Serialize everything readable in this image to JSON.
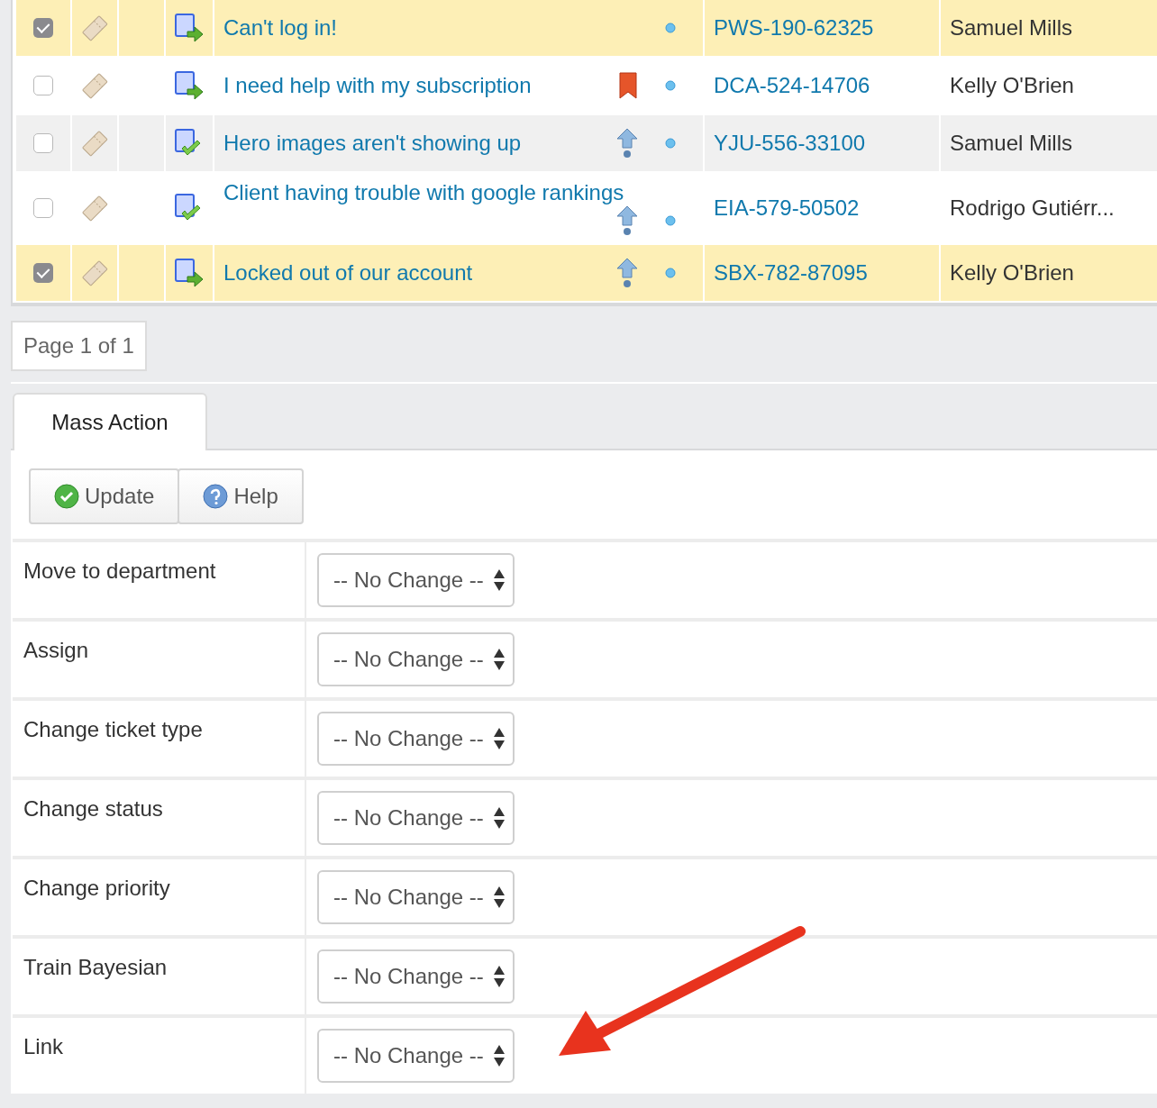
{
  "tickets": [
    {
      "selected": true,
      "status_icon": {
        "kind": "moved"
      },
      "subject": "Can't log in!",
      "ticket_id": "PWS-190-62325",
      "owner": "Samuel Mills"
    },
    {
      "selected": false,
      "status_icon": {
        "kind": "moved"
      },
      "subject": "I need help with my subscription",
      "flag_icon": {
        "kind": "bookmark"
      },
      "ticket_id": "DCA-524-14706",
      "owner": "Kelly O'Brien"
    },
    {
      "selected": false,
      "status_icon": {
        "kind": "done"
      },
      "subject": "Hero images aren't showing up",
      "flag_icon": {
        "kind": "priority"
      },
      "ticket_id": "YJU-556-33100",
      "owner": "Samuel Mills"
    },
    {
      "selected": false,
      "status_icon": {
        "kind": "done"
      },
      "subject": "Client having trouble with google rankings",
      "flag_icon": {
        "kind": "priority"
      },
      "ticket_id": "EIA-579-50502",
      "owner": "Rodrigo Gutiérr..."
    },
    {
      "selected": true,
      "status_icon": {
        "kind": "moved"
      },
      "subject": "Locked out of our account",
      "flag_icon": {
        "kind": "priority"
      },
      "ticket_id": "SBX-782-87095",
      "owner": "Kelly O'Brien"
    }
  ],
  "pagination": "Page 1 of 1",
  "tabs": [
    {
      "label": "Mass Action",
      "selected": true
    }
  ],
  "toolbar": [
    {
      "kind": "update",
      "label": "Update"
    },
    {
      "kind": "help",
      "label": "Help"
    }
  ],
  "fields": [
    {
      "label": "Move to department",
      "value": "-- No Change --"
    },
    {
      "label": "Assign",
      "value": "-- No Change --"
    },
    {
      "label": "Change ticket type",
      "value": "-- No Change --"
    },
    {
      "label": "Change status",
      "value": "-- No Change --"
    },
    {
      "label": "Change priority",
      "value": "-- No Change --"
    },
    {
      "label": "Train Bayesian",
      "value": "-- No Change --"
    },
    {
      "label": "Link",
      "value": "-- No Change --"
    }
  ]
}
